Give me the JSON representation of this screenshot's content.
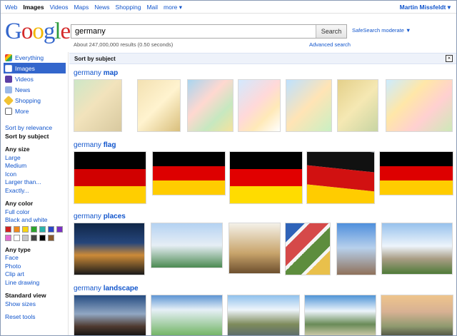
{
  "topnav": {
    "items": [
      "Web",
      "Images",
      "Videos",
      "Maps",
      "News",
      "Shopping",
      "Mail",
      "more ▾"
    ],
    "active": "Images",
    "user": "Martin Missfeldt ▾"
  },
  "logo": {
    "text": "Google",
    "colors": [
      "#3366cc",
      "#d42a2a",
      "#f2b600",
      "#3366cc",
      "#2b9b3c",
      "#d42a2a"
    ]
  },
  "search": {
    "query": "germany",
    "button": "Search",
    "safesearch": "SafeSearch moderate ▼",
    "results_text": "About 247,000,000 results (0.50 seconds)",
    "advanced_search": "Advanced search"
  },
  "sidebar": {
    "items": [
      {
        "label": "Everything",
        "icon": "everything-icon"
      },
      {
        "label": "Images",
        "icon": "images-icon",
        "selected": true
      },
      {
        "label": "Videos",
        "icon": "videos-icon"
      },
      {
        "label": "News",
        "icon": "news-icon"
      },
      {
        "label": "Shopping",
        "icon": "shopping-icon"
      },
      {
        "label": "More",
        "icon": "more-icon"
      }
    ],
    "sort": [
      "Sort by relevance",
      "Sort by subject"
    ],
    "any_size": [
      "Any size",
      "Large",
      "Medium",
      "Icon",
      "Larger than...",
      "Exactly..."
    ],
    "any_color": [
      "Any color",
      "Full color",
      "Black and white"
    ],
    "swatches": [
      "#d12020",
      "#f08a1c",
      "#f8d511",
      "#2ca52c",
      "#2bb3ab",
      "#2a47c8",
      "#7b2fc4",
      "#e36ad2",
      "#ffffff",
      "#c7c7c7",
      "#444444",
      "#000000",
      "#8a5a2b"
    ],
    "any_type": [
      "Any type",
      "Face",
      "Photo",
      "Clip art",
      "Line drawing"
    ],
    "standard_view": [
      "Standard view",
      "Show sizes"
    ],
    "reset": "Reset tools"
  },
  "subject_bar": {
    "label": "Sort by subject",
    "close": "×"
  },
  "groups": [
    {
      "query": "germany",
      "subject": "map"
    },
    {
      "query": "germany",
      "subject": "flag"
    },
    {
      "query": "germany",
      "subject": "places"
    },
    {
      "query": "germany",
      "subject": "landscape"
    }
  ]
}
